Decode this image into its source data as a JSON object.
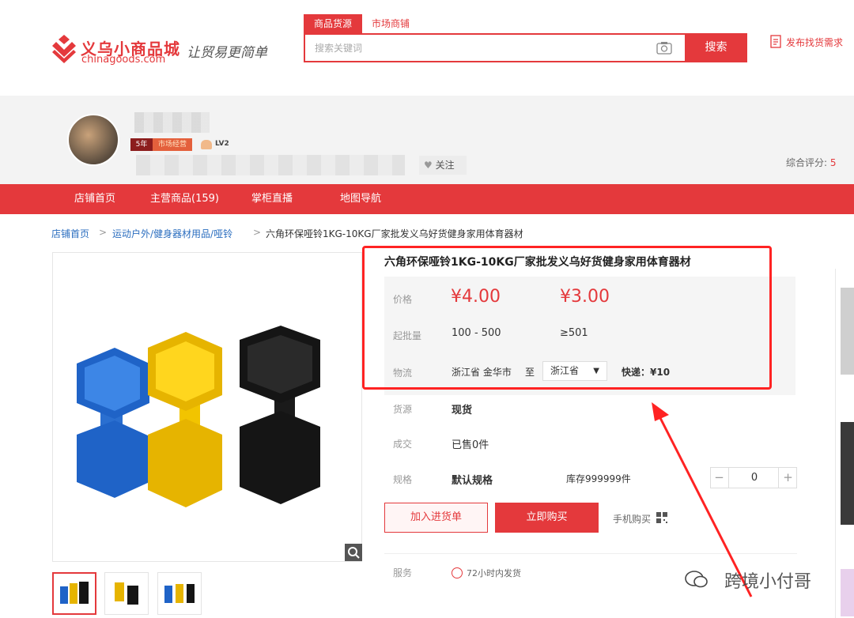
{
  "header": {
    "logo_cn": "义乌小商品城",
    "logo_en": "chinagoods.com",
    "slogan": "让贸易更简单",
    "search_tabs": [
      "商品货源",
      "市场商铺"
    ],
    "search_placeholder": "搜索关键词",
    "search_button": "搜索",
    "publish_link": "发布找货需求"
  },
  "store": {
    "level": "LV2",
    "badge_a": "5年",
    "badge_b": "市场经营",
    "follow_label": "关注",
    "rating_label": "综合评分:",
    "rating_value": "5"
  },
  "nav": [
    "店铺首页",
    "主营商品(159)",
    "掌柜直播",
    "地图导航"
  ],
  "breadcrumb": {
    "home": "店铺首页",
    "category": "运动户外/健身器材用品/哑铃",
    "current": "六角环保哑铃1KG-10KG厂家批发义乌好货健身家用体育器材",
    "sep": ">"
  },
  "product": {
    "title": "六角环保哑铃1KG-10KG厂家批发义乌好货健身家用体育器材",
    "price_label": "价格",
    "price_1": "¥4.00",
    "price_2": "¥3.00",
    "moq_label": "起批量",
    "moq_1": "100 - 500",
    "moq_2": "≥501",
    "logistics_label": "物流",
    "origin": "浙江省 金华市",
    "to_word": "至",
    "dest": "浙江省",
    "express": "快递：¥10",
    "source_label": "货源",
    "source_value": "现货",
    "deal_label": "成交",
    "deal_value": "已售0件",
    "spec_label": "规格",
    "spec_value": "默认规格",
    "stock": "库存999999件",
    "quantity": "0",
    "minus": "−",
    "plus": "+",
    "add_cart": "加入进货单",
    "buy_now": "立即购买",
    "mobile_buy": "手机购买",
    "service_label": "服务",
    "service_value": "72小时内发货"
  },
  "watermark": "跨境小付哥",
  "colors": {
    "brand": "#e4393c",
    "highlight": "#ff2323"
  }
}
